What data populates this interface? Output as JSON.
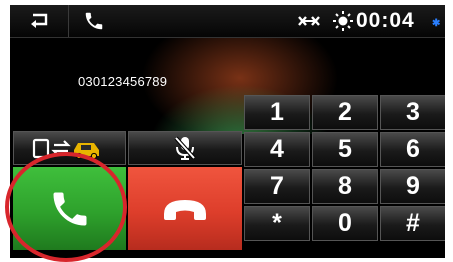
{
  "topbar": {
    "back_icon": "back-arrow-icon",
    "phone_icon": "phone-icon",
    "link_icon": "phone-link-icon",
    "sun_icon": "brightness-sun-icon",
    "time": "00:04",
    "bt_icon": "bluetooth-icon"
  },
  "display": {
    "number": "030123456789"
  },
  "keypad": {
    "keys": [
      "1",
      "2",
      "3",
      "4",
      "5",
      "6",
      "7",
      "8",
      "9",
      "*",
      "0",
      "#"
    ]
  },
  "actions": {
    "transfer_icon": "phone-to-car-transfer-icon",
    "mute_icon": "mic-mute-icon",
    "call_icon": "call-answer-icon",
    "end_icon": "call-end-icon"
  },
  "colors": {
    "call_green": "#2ea12c",
    "end_red": "#dd3e2b",
    "annotation_red": "#d8262c",
    "bluetooth_blue": "#2a7fff",
    "car_yellow": "#e8b400"
  }
}
